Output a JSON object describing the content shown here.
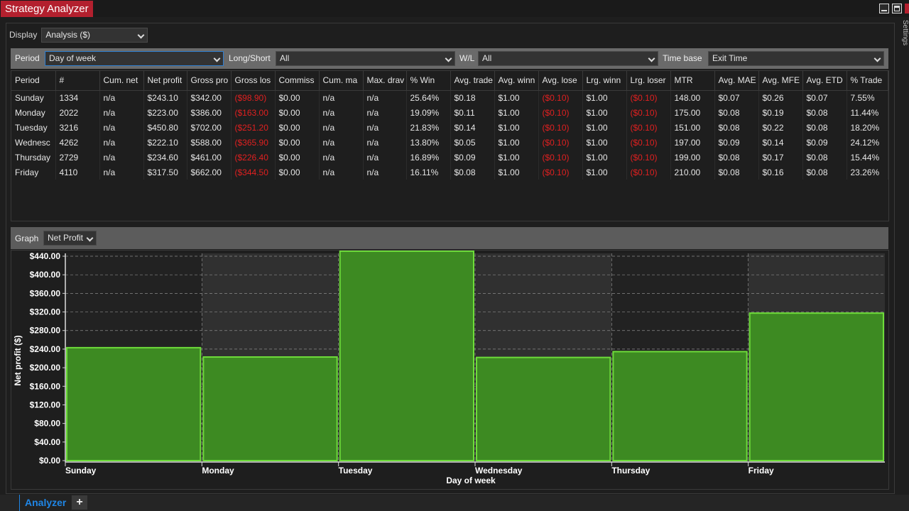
{
  "window": {
    "title": "Strategy Analyzer",
    "settings_tab": "Settings"
  },
  "display": {
    "label": "Display",
    "value": "Analysis ($)"
  },
  "filters": {
    "period_label": "Period",
    "period_value": "Day of week",
    "longshort_label": "Long/Short",
    "longshort_value": "All",
    "wl_label": "W/L",
    "wl_value": "All",
    "timebase_label": "Time base",
    "timebase_value": "Exit Time"
  },
  "table": {
    "columns": [
      "Period",
      "#",
      "Cum. net",
      "Net profit",
      "Gross pro",
      "Gross los",
      "Commiss",
      "Cum. ma",
      "Max. drav",
      "% Win",
      "Avg. trade",
      "Avg. winn",
      "Avg. lose",
      "Lrg. winn",
      "Lrg. loser",
      "MTR",
      "Avg. MAE",
      "Avg. MFE",
      "Avg. ETD",
      "% Trade"
    ],
    "rows": [
      [
        "Sunday",
        "1334",
        "n/a",
        "$243.10",
        "$342.00",
        "($98.90)",
        "$0.00",
        "n/a",
        "n/a",
        "25.64%",
        "$0.18",
        "$1.00",
        "($0.10)",
        "$1.00",
        "($0.10)",
        "148.00",
        "$0.07",
        "$0.26",
        "$0.07",
        "7.55%"
      ],
      [
        "Monday",
        "2022",
        "n/a",
        "$223.00",
        "$386.00",
        "($163.00",
        "$0.00",
        "n/a",
        "n/a",
        "19.09%",
        "$0.11",
        "$1.00",
        "($0.10)",
        "$1.00",
        "($0.10)",
        "175.00",
        "$0.08",
        "$0.19",
        "$0.08",
        "11.44%"
      ],
      [
        "Tuesday",
        "3216",
        "n/a",
        "$450.80",
        "$702.00",
        "($251.20",
        "$0.00",
        "n/a",
        "n/a",
        "21.83%",
        "$0.14",
        "$1.00",
        "($0.10)",
        "$1.00",
        "($0.10)",
        "151.00",
        "$0.08",
        "$0.22",
        "$0.08",
        "18.20%"
      ],
      [
        "Wednesc",
        "4262",
        "n/a",
        "$222.10",
        "$588.00",
        "($365.90",
        "$0.00",
        "n/a",
        "n/a",
        "13.80%",
        "$0.05",
        "$1.00",
        "($0.10)",
        "$1.00",
        "($0.10)",
        "197.00",
        "$0.09",
        "$0.14",
        "$0.09",
        "24.12%"
      ],
      [
        "Thursday",
        "2729",
        "n/a",
        "$234.60",
        "$461.00",
        "($226.40",
        "$0.00",
        "n/a",
        "n/a",
        "16.89%",
        "$0.09",
        "$1.00",
        "($0.10)",
        "$1.00",
        "($0.10)",
        "199.00",
        "$0.08",
        "$0.17",
        "$0.08",
        "15.44%"
      ],
      [
        "Friday",
        "4110",
        "n/a",
        "$317.50",
        "$662.00",
        "($344.50",
        "$0.00",
        "n/a",
        "n/a",
        "16.11%",
        "$0.08",
        "$1.00",
        "($0.10)",
        "$1.00",
        "($0.10)",
        "210.00",
        "$0.08",
        "$0.16",
        "$0.08",
        "23.26%"
      ]
    ],
    "negative_columns": [
      5,
      12,
      14
    ]
  },
  "graph": {
    "label": "Graph",
    "value": "Net Profit"
  },
  "chart_data": {
    "type": "bar",
    "categories": [
      "Sunday",
      "Monday",
      "Tuesday",
      "Wednesday",
      "Thursday",
      "Friday"
    ],
    "values": [
      243.1,
      223.0,
      450.8,
      222.1,
      234.6,
      317.5
    ],
    "xlabel": "Day of week",
    "ylabel": "Net profit ($)",
    "ylim": [
      0,
      440
    ],
    "yticks": [
      0,
      40,
      80,
      120,
      160,
      200,
      240,
      280,
      320,
      360,
      400,
      440
    ],
    "ytick_labels": [
      "$0.00",
      "$40.00",
      "$80.00",
      "$120.00",
      "$160.00",
      "$200.00",
      "$240.00",
      "$280.00",
      "$320.00",
      "$360.00",
      "$400.00",
      "$440.00"
    ],
    "grid": true,
    "bar_color": "#3d8a22",
    "bar_edge_color": "#6edc3a"
  },
  "bottom": {
    "active_tab": "Analyzer",
    "add_tab": "+"
  }
}
